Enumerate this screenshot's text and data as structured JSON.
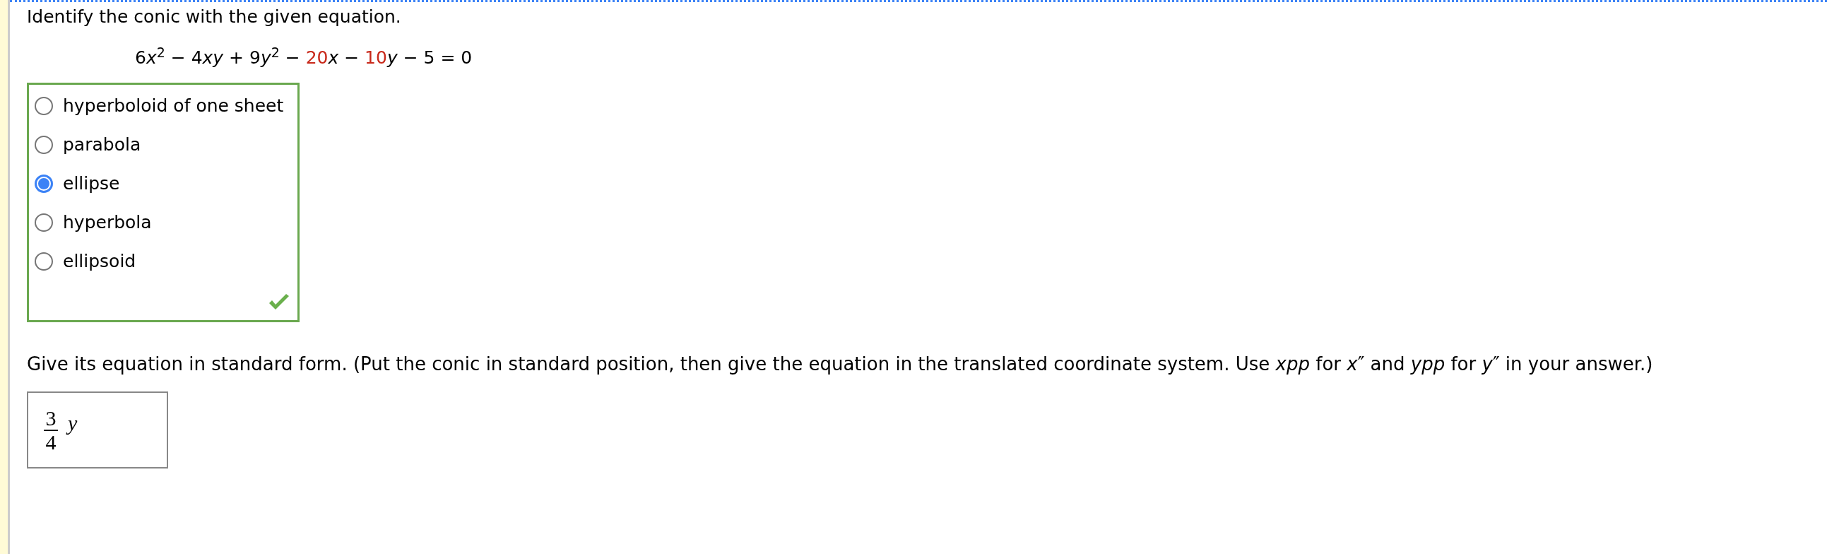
{
  "question_1": {
    "prompt": "Identify the conic with the given equation.",
    "equation": [
      {
        "text": "6",
        "kind": "plain",
        "color": "#000000"
      },
      {
        "text": "x",
        "kind": "var",
        "color": "#000000"
      },
      {
        "text": "2",
        "kind": "sup",
        "color": "#000000"
      },
      {
        "text": " − 4",
        "kind": "plain",
        "color": "#000000"
      },
      {
        "text": "xy",
        "kind": "var",
        "color": "#000000"
      },
      {
        "text": " + 9",
        "kind": "plain",
        "color": "#000000"
      },
      {
        "text": "y",
        "kind": "var",
        "color": "#000000"
      },
      {
        "text": "2",
        "kind": "sup",
        "color": "#000000"
      },
      {
        "text": " − ",
        "kind": "plain",
        "color": "#000000"
      },
      {
        "text": "20",
        "kind": "plain",
        "color": "#c8291b"
      },
      {
        "text": "x",
        "kind": "var",
        "color": "#000000"
      },
      {
        "text": " − ",
        "kind": "plain",
        "color": "#000000"
      },
      {
        "text": "10",
        "kind": "plain",
        "color": "#c8291b"
      },
      {
        "text": "y",
        "kind": "var",
        "color": "#000000"
      },
      {
        "text": " − 5 = 0",
        "kind": "plain",
        "color": "#000000"
      }
    ],
    "options": [
      {
        "label": "hyperboloid of one sheet",
        "selected": false
      },
      {
        "label": "parabola",
        "selected": false
      },
      {
        "label": "ellipse",
        "selected": true
      },
      {
        "label": "hyperbola",
        "selected": false
      },
      {
        "label": "ellipsoid",
        "selected": false
      }
    ],
    "correct": true
  },
  "question_2": {
    "prompt": "Give its equation in standard form. (Put the conic in standard position, then give the equation in the translated coordinate system. Use *xpp* for *x*″ and *ypp* for *y*″ in your answer.)",
    "answer": {
      "numerator": "3",
      "denominator": "4",
      "variable": "y"
    }
  }
}
